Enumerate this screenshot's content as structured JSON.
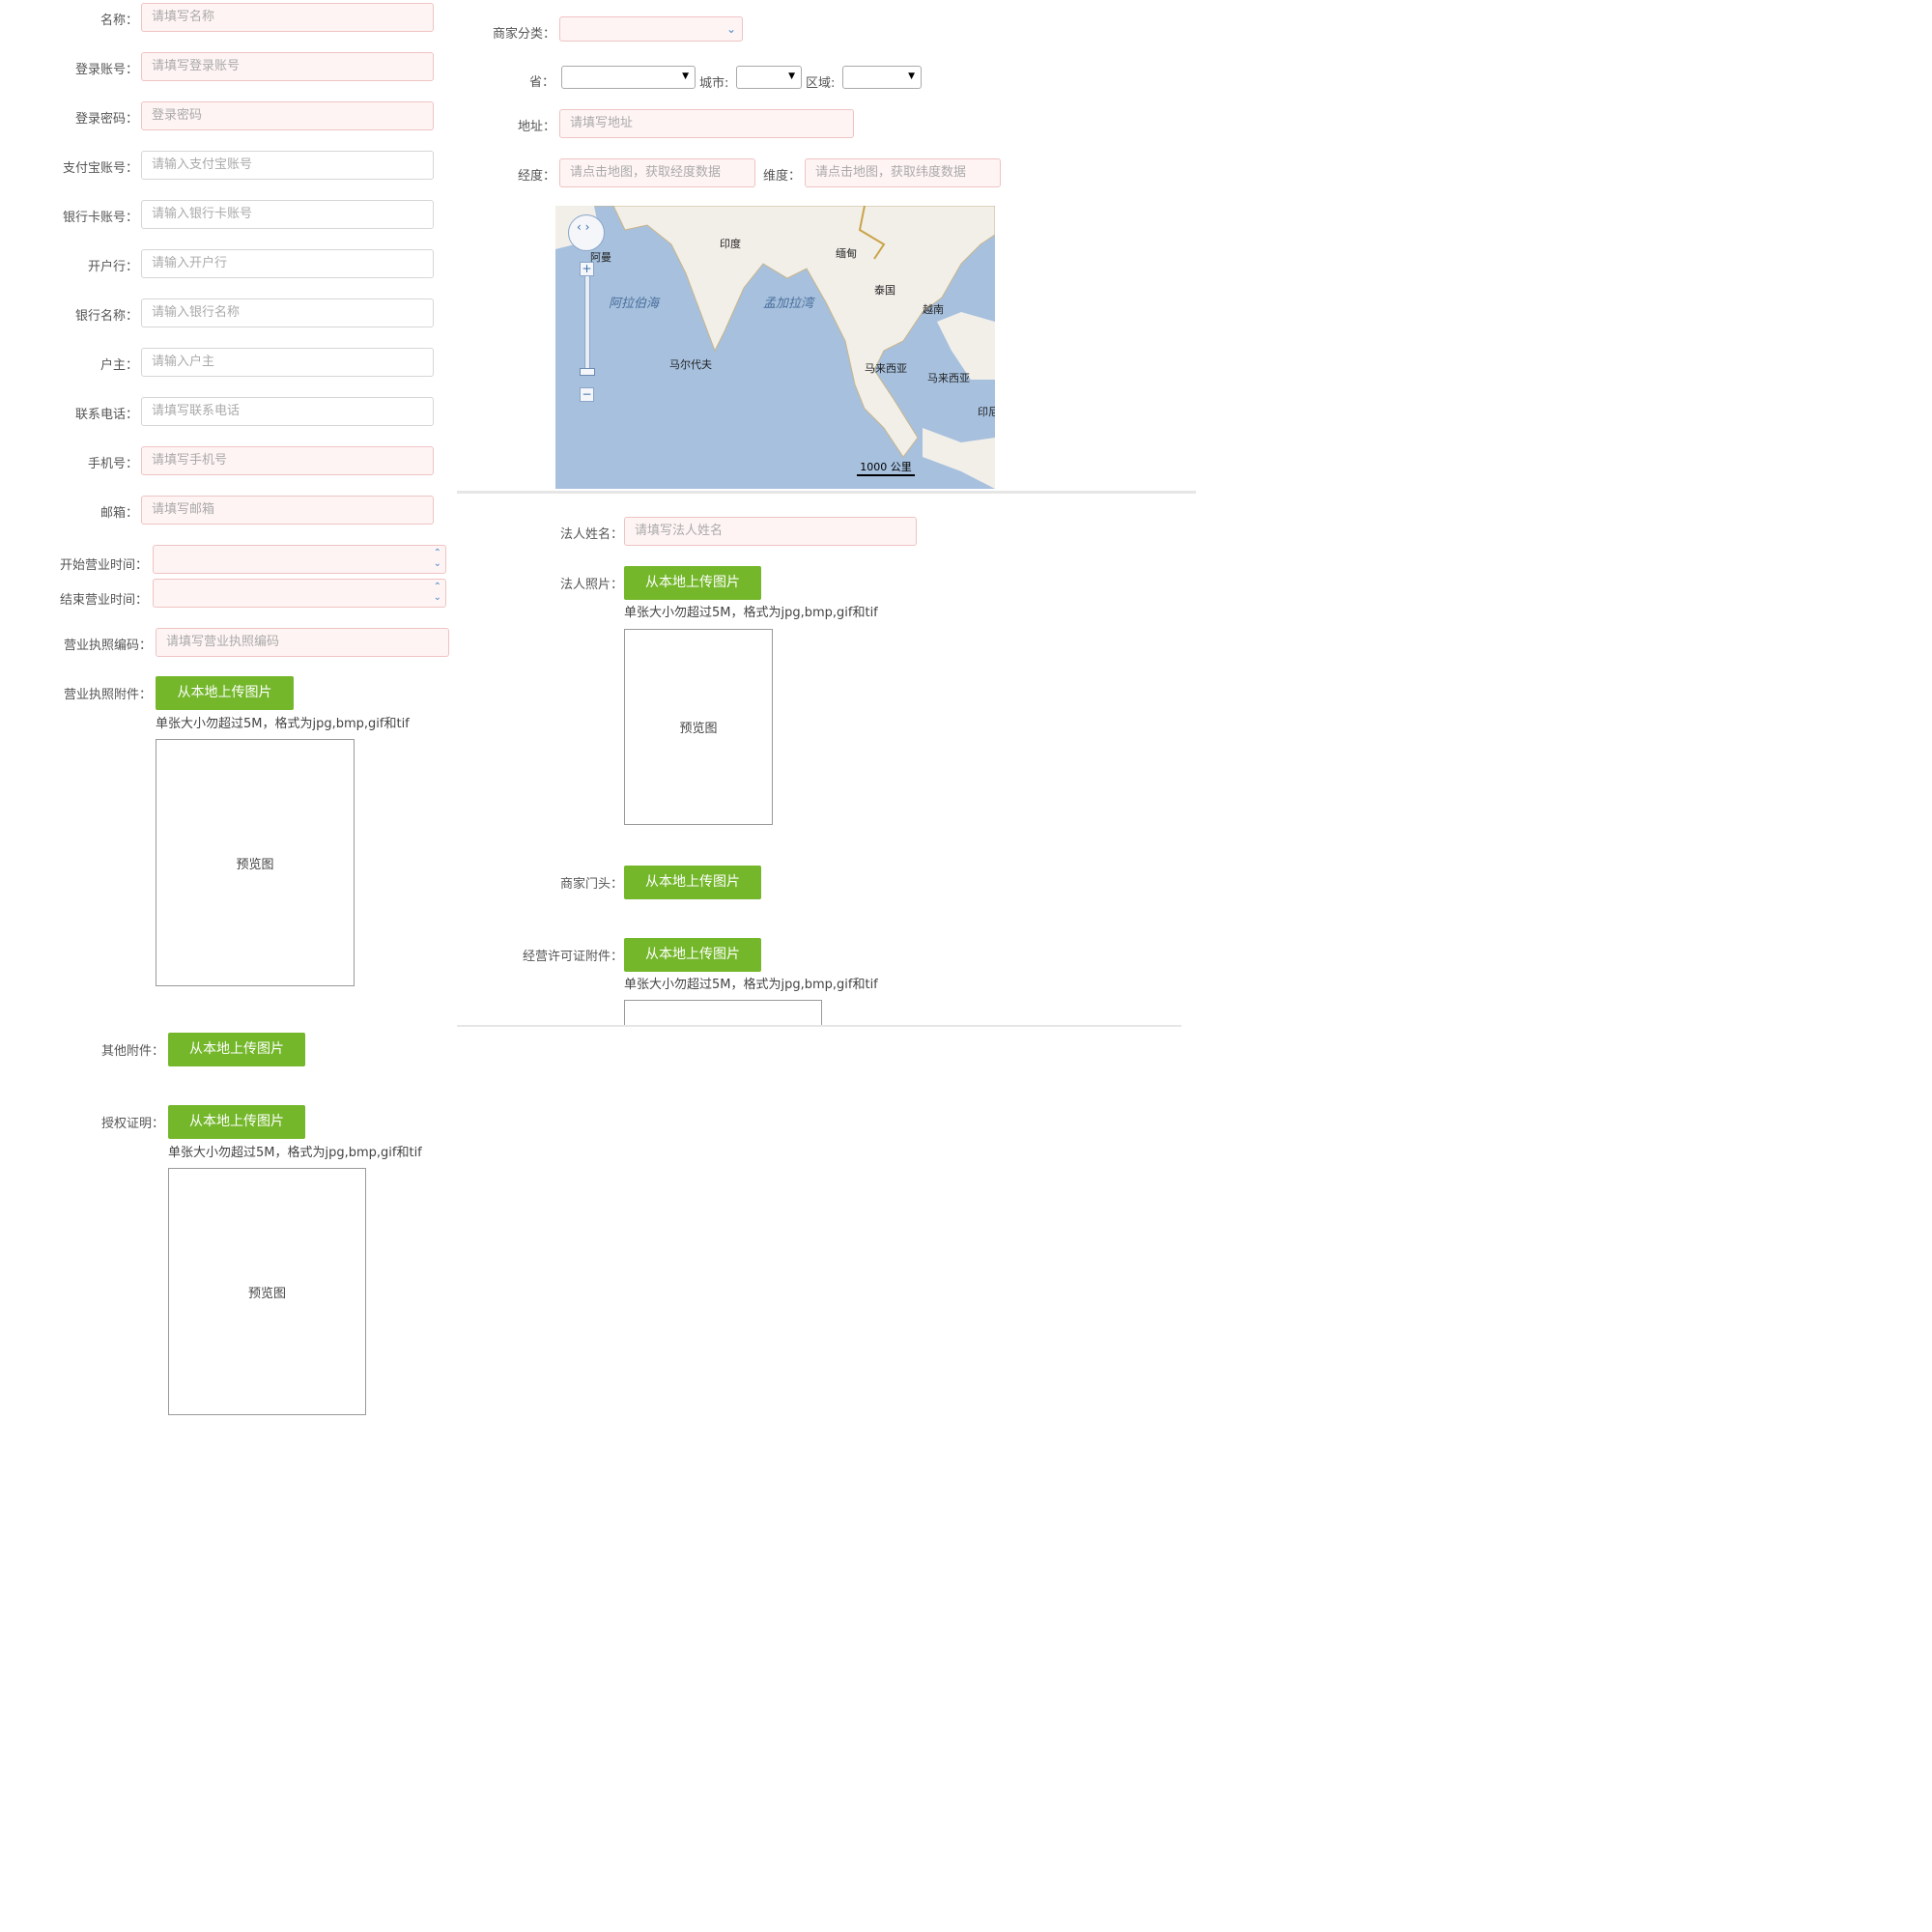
{
  "left": {
    "name": {
      "label": "名称：",
      "placeholder": "请填写名称"
    },
    "login": {
      "label": "登录账号：",
      "placeholder": "请填写登录账号"
    },
    "password": {
      "label": "登录密码：",
      "placeholder": "登录密码"
    },
    "alipay": {
      "label": "支付宝账号：",
      "placeholder": "请输入支付宝账号"
    },
    "bankcard": {
      "label": "银行卡账号：",
      "placeholder": "请输入银行卡账号"
    },
    "openbank": {
      "label": "开户行：",
      "placeholder": "请输入开户行"
    },
    "bankname": {
      "label": "银行名称：",
      "placeholder": "请输入银行名称"
    },
    "holder": {
      "label": "户主：",
      "placeholder": "请输入户主"
    },
    "phone": {
      "label": "联系电话：",
      "placeholder": "请填写联系电话"
    },
    "mobile": {
      "label": "手机号：",
      "placeholder": "请填写手机号"
    },
    "email": {
      "label": "邮箱：",
      "placeholder": "请填写邮箱"
    },
    "open_time": {
      "label": "开始营业时间："
    },
    "close_time": {
      "label": "结束营业时间："
    },
    "license_code": {
      "label": "营业执照编码：",
      "placeholder": "请填写营业执照编码"
    },
    "license_attach": {
      "label": "营业执照附件："
    },
    "other_attach": {
      "label": "其他附件："
    },
    "auth_proof": {
      "label": "授权证明："
    }
  },
  "right": {
    "category": {
      "label": "商家分类："
    },
    "province": {
      "label": "省："
    },
    "city": {
      "label": "城市:"
    },
    "district": {
      "label": "区域:"
    },
    "address": {
      "label": "地址：",
      "placeholder": "请填写地址"
    },
    "longitude": {
      "label": "经度：",
      "placeholder": "请点击地图，获取经度数据"
    },
    "latitude": {
      "label": "维度：",
      "placeholder": "请点击地图，获取纬度数据"
    },
    "legal_name": {
      "label": "法人姓名：",
      "placeholder": "请填写法人姓名"
    },
    "legal_photo": {
      "label": "法人照片："
    },
    "storefront": {
      "label": "商家门头："
    },
    "permit_attach": {
      "label": "经营许可证附件："
    }
  },
  "upload_button": "从本地上传图片",
  "upload_hint": "单张大小勿超过5M，格式为jpg,bmp,gif和tif",
  "preview_label": "预览图",
  "map": {
    "labels": {
      "oman": "阿曼",
      "india": "印度",
      "myanmar": "缅甸",
      "thailand": "泰国",
      "vietnam": "越南",
      "arabian_sea": "阿拉伯海",
      "bay_of_bengal": "孟加拉湾",
      "maldives": "马尔代夫",
      "malaysia1": "马来西亚",
      "malaysia2": "马来西亚",
      "indonesia": "印尼"
    },
    "scale": "1000 公里"
  },
  "colors": {
    "button": "#74b72b",
    "required_bg": "#fff4f4",
    "sea": "#a6c0de",
    "land": "#f2efe9"
  }
}
